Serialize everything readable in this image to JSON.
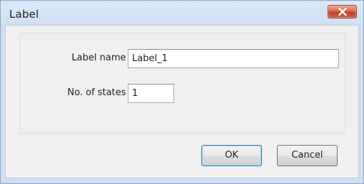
{
  "dialog": {
    "title": "Label",
    "close_icon": "close-x-icon"
  },
  "form": {
    "label_name_label": "Label name :",
    "label_name_value": "Label_1",
    "states_label": "No. of states :",
    "states_value": "1"
  },
  "buttons": {
    "ok": "OK",
    "cancel": "Cancel"
  },
  "colors": {
    "close_button": "#c0432a",
    "ok_focus_border": "#3c7fb1",
    "titlebar": "#cfe0f3"
  }
}
